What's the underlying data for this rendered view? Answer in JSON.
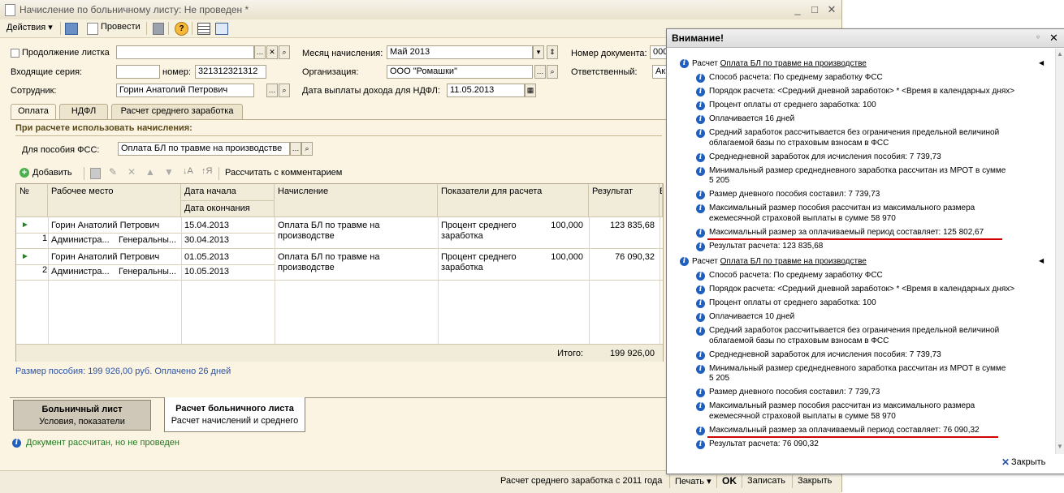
{
  "window": {
    "title": "Начисление по больничному листу: Не проведен *",
    "controls": {
      "minimize": "_",
      "maximize": "□",
      "close": "✕"
    }
  },
  "toolbar": {
    "actions": "Действия ▾",
    "post": "Провести"
  },
  "form": {
    "continuation_label": "Продолжение листка",
    "incoming_series_label": "Входящие серия:",
    "number_label": "номер:",
    "number_value": "321312321312",
    "employee_label": "Сотрудник:",
    "employee_value": "Горин Анатолий Петрович",
    "month_label": "Месяц начисления:",
    "month_value": "Май 2013",
    "org_label": "Организация:",
    "org_value": "ООО \"Ромашки\"",
    "pay_date_label": "Дата выплаты дохода для НДФЛ:",
    "pay_date_value": "11.05.2013",
    "doc_number_label": "Номер документа:",
    "doc_number_value": "000",
    "responsible_label": "Ответственный:",
    "responsible_value": "Ак"
  },
  "tabs": [
    {
      "label": "Оплата"
    },
    {
      "label": "НДФЛ"
    },
    {
      "label": "Расчет среднего заработка"
    }
  ],
  "payment": {
    "section_title": "При расчете использовать начисления:",
    "fss_label": "Для пособия ФСС:",
    "fss_value": "Оплата БЛ по травме на производстве",
    "add_label": "Добавить",
    "calc_comment_label": "Рассчитать с комментарием"
  },
  "table": {
    "headers": {
      "num": "№",
      "workplace": "Рабочее место",
      "start": "Дата начала",
      "end": "Дата окончания",
      "accrual": "Начисление",
      "indicators": "Показатели для расчета",
      "result": "Результат",
      "extra": "В"
    },
    "rows": [
      {
        "num": "1",
        "employee": "Горин Анатолий Петрович",
        "dept": "Администра...",
        "position": "Генеральны...",
        "start": "15.04.2013",
        "end": "30.04.2013",
        "accrual_l1": "Оплата БЛ по травме на",
        "accrual_l2": "производстве",
        "ind_l1": "Процент среднего",
        "ind_l2": "заработка",
        "ind_value": "100,000",
        "result": "123 835,68"
      },
      {
        "num": "2",
        "employee": "Горин Анатолий Петрович",
        "dept": "Администра...",
        "position": "Генеральны...",
        "start": "01.05.2013",
        "end": "10.05.2013",
        "accrual_l1": "Оплата БЛ по травме на",
        "accrual_l2": "производстве",
        "ind_l1": "Процент среднего",
        "ind_l2": "заработка",
        "ind_value": "100,000",
        "result": "76 090,32"
      }
    ],
    "total_label": "Итого:",
    "total_value": "199 926,00"
  },
  "summary_text": "Размер пособия: 199 926,00 руб. Оплачено 26 дней",
  "nav": {
    "panel1_title": "Больничный лист",
    "panel1_sub": "Условия, показатели",
    "panel2_title": "Расчет больничного листа",
    "panel2_sub": "Расчет начислений и среднего"
  },
  "info_text": "Документ рассчитан, но не проведен",
  "statusbar": {
    "avg_calc": "Расчет среднего заработка с 2011 года",
    "print": "Печать ▾",
    "ok": "OK",
    "write": "Записать",
    "close": "Закрыть"
  },
  "messages": {
    "title": "Внимание!",
    "close_label": "Закрыть",
    "groups": [
      {
        "prefix": "Расчет ",
        "link": "Оплата БЛ по травме на производстве",
        "lines": [
          [
            "Способ расчета: По среднему заработку ФСС"
          ],
          [
            "Порядок расчета: <Средний дневной заработок> * <Время в календарных днях>"
          ],
          [
            "Процент оплаты от среднего заработка: 100"
          ],
          [
            "Оплачивается 16 дней"
          ],
          [
            "Средний заработок рассчитывается без ограничения предельной величиной",
            "облагаемой базы по страховым взносам в ФСС"
          ],
          [
            "Среднедневной заработок для исчисления пособия: 7 739,73"
          ],
          [
            "Минимальный размер среднедневного заработка рассчитан из МРОТ в сумме",
            "5 205"
          ],
          [
            "Размер дневного пособия составил: 7 739,73"
          ],
          [
            "Максимальный размер пособия рассчитан из максимального размера",
            "ежемесячной страховой выплаты в сумме 58 970"
          ],
          [
            "Максимальный размер за оплачиваемый период составляет: 125 802,67"
          ],
          [
            "Результат расчета: 123 835,68"
          ]
        ]
      },
      {
        "prefix": "Расчет ",
        "link": "Оплата БЛ по травме на производстве",
        "lines": [
          [
            "Способ расчета: По среднему заработку ФСС"
          ],
          [
            "Порядок расчета: <Средний дневной заработок> * <Время в календарных днях>"
          ],
          [
            "Процент оплаты от среднего заработка: 100"
          ],
          [
            "Оплачивается 10 дней"
          ],
          [
            "Средний заработок рассчитывается без ограничения предельной величиной",
            "облагаемой базы по страховым взносам в ФСС"
          ],
          [
            "Среднедневной заработок для исчисления пособия: 7 739,73"
          ],
          [
            "Минимальный размер среднедневного заработка рассчитан из МРОТ в сумме",
            "5 205"
          ],
          [
            "Размер дневного пособия составил: 7 739,73"
          ],
          [
            "Максимальный размер пособия рассчитан из максимального размера",
            "ежемесячной страховой выплаты в сумме 58 970"
          ],
          [
            "Максимальный размер за оплачиваемый период составляет: 76 090,32"
          ],
          [
            "Результат расчета: 76 090,32"
          ]
        ]
      }
    ]
  }
}
